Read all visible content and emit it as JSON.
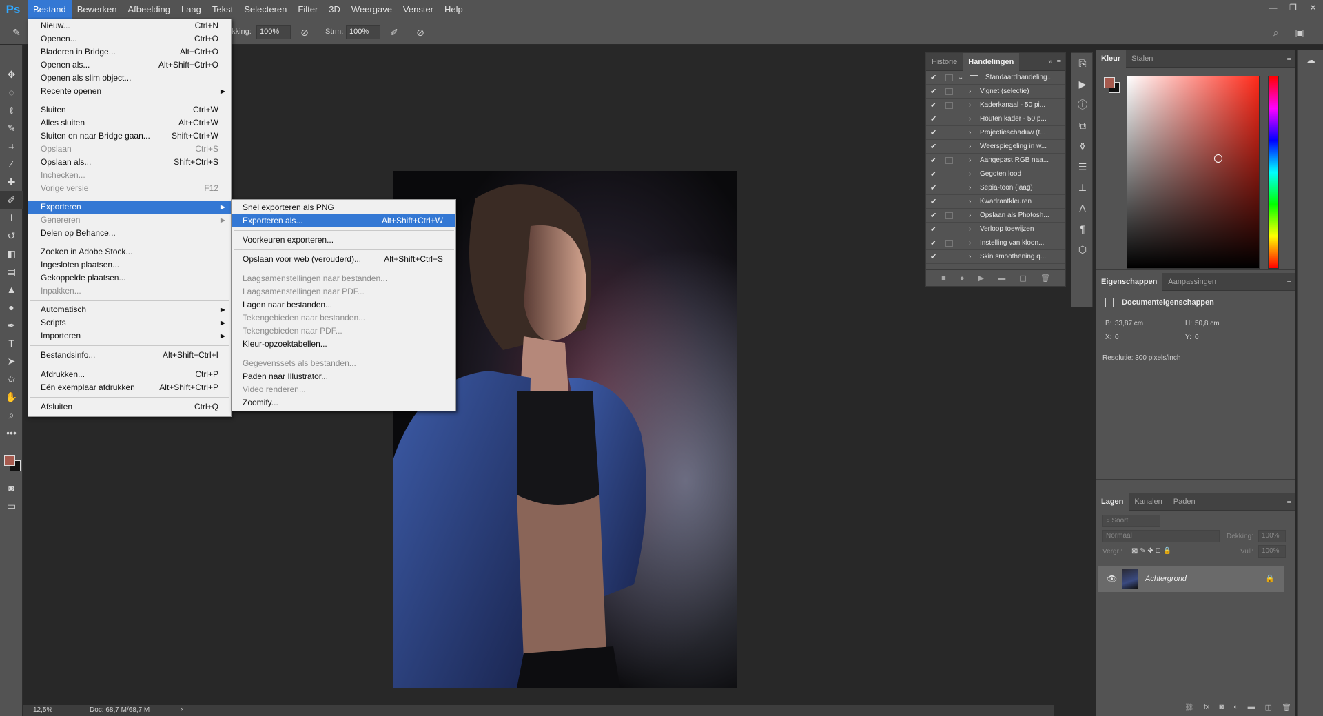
{
  "app": {
    "logo": "Ps"
  },
  "menubar": {
    "items": [
      "Bestand",
      "Bewerken",
      "Afbeelding",
      "Laag",
      "Tekst",
      "Selecteren",
      "Filter",
      "3D",
      "Weergave",
      "Venster",
      "Help"
    ],
    "active": "Bestand"
  },
  "window_controls": [
    "—",
    "❐",
    "✕"
  ],
  "optionsbar": {
    "opacity_label": "ekking:",
    "opacity_value": "100%",
    "flow_label": "Strm:",
    "flow_value": "100%"
  },
  "file_menu": {
    "items": [
      {
        "label": "Nieuw...",
        "shortcut": "Ctrl+N"
      },
      {
        "label": "Openen...",
        "shortcut": "Ctrl+O"
      },
      {
        "label": "Bladeren in Bridge...",
        "shortcut": "Alt+Ctrl+O"
      },
      {
        "label": "Openen als...",
        "shortcut": "Alt+Shift+Ctrl+O"
      },
      {
        "label": "Openen als slim object...",
        "shortcut": ""
      },
      {
        "label": "Recente openen",
        "shortcut": "",
        "submenu": true
      },
      {
        "label": "Sluiten",
        "shortcut": "Ctrl+W"
      },
      {
        "label": "Alles sluiten",
        "shortcut": "Alt+Ctrl+W"
      },
      {
        "label": "Sluiten en naar Bridge gaan...",
        "shortcut": "Shift+Ctrl+W"
      },
      {
        "label": "Opslaan",
        "shortcut": "Ctrl+S",
        "disabled": true
      },
      {
        "label": "Opslaan als...",
        "shortcut": "Shift+Ctrl+S"
      },
      {
        "label": "Inchecken...",
        "shortcut": "",
        "disabled": true
      },
      {
        "label": "Vorige versie",
        "shortcut": "F12",
        "disabled": true
      },
      {
        "label": "Exporteren",
        "shortcut": "",
        "submenu": true,
        "highlighted": true
      },
      {
        "label": "Genereren",
        "shortcut": "",
        "submenu": true,
        "disabled": true
      },
      {
        "label": "Delen op Behance...",
        "shortcut": ""
      },
      {
        "label": "Zoeken in Adobe Stock...",
        "shortcut": ""
      },
      {
        "label": "Ingesloten plaatsen...",
        "shortcut": ""
      },
      {
        "label": "Gekoppelde plaatsen...",
        "shortcut": ""
      },
      {
        "label": "Inpakken...",
        "shortcut": "",
        "disabled": true
      },
      {
        "label": "Automatisch",
        "shortcut": "",
        "submenu": true
      },
      {
        "label": "Scripts",
        "shortcut": "",
        "submenu": true
      },
      {
        "label": "Importeren",
        "shortcut": "",
        "submenu": true
      },
      {
        "label": "Bestandsinfo...",
        "shortcut": "Alt+Shift+Ctrl+I"
      },
      {
        "label": "Afdrukken...",
        "shortcut": "Ctrl+P"
      },
      {
        "label": "Eén exemplaar afdrukken",
        "shortcut": "Alt+Shift+Ctrl+P"
      },
      {
        "label": "Afsluiten",
        "shortcut": "Ctrl+Q"
      }
    ]
  },
  "export_menu": {
    "items": [
      {
        "label": "Snel exporteren als PNG",
        "shortcut": ""
      },
      {
        "label": "Exporteren als...",
        "shortcut": "Alt+Shift+Ctrl+W",
        "highlighted": true
      },
      {
        "label": "Voorkeuren exporteren...",
        "shortcut": ""
      },
      {
        "label": "Opslaan voor web (verouderd)...",
        "shortcut": "Alt+Shift+Ctrl+S"
      },
      {
        "label": "Laagsamenstellingen naar bestanden...",
        "shortcut": "",
        "disabled": true
      },
      {
        "label": "Laagsamenstellingen naar PDF...",
        "shortcut": "",
        "disabled": true
      },
      {
        "label": "Lagen naar bestanden...",
        "shortcut": ""
      },
      {
        "label": "Tekengebieden naar bestanden...",
        "shortcut": "",
        "disabled": true
      },
      {
        "label": "Tekengebieden naar PDF...",
        "shortcut": "",
        "disabled": true
      },
      {
        "label": "Kleur-opzoektabellen...",
        "shortcut": ""
      },
      {
        "label": "Gegevenssets als bestanden...",
        "shortcut": "",
        "disabled": true
      },
      {
        "label": "Paden naar Illustrator...",
        "shortcut": ""
      },
      {
        "label": "Video renderen...",
        "shortcut": "",
        "disabled": true
      },
      {
        "label": "Zoomify...",
        "shortcut": ""
      }
    ]
  },
  "actions_panel": {
    "tabs": [
      "Historie",
      "Handelingen"
    ],
    "active_tab": "Handelingen",
    "set_name": "Standaardhandeling...",
    "actions": [
      {
        "name": "Vignet (selectie)",
        "dialog": true
      },
      {
        "name": "Kaderkanaal - 50 pi...",
        "dialog": true
      },
      {
        "name": "Houten kader - 50 p...",
        "dialog": false
      },
      {
        "name": "Projectieschaduw (t...",
        "dialog": false
      },
      {
        "name": "Weerspiegeling in w...",
        "dialog": false
      },
      {
        "name": "Aangepast RGB naa...",
        "dialog": true
      },
      {
        "name": "Gegoten lood",
        "dialog": false
      },
      {
        "name": "Sepia-toon (laag)",
        "dialog": false
      },
      {
        "name": "Kwadrantkleuren",
        "dialog": false
      },
      {
        "name": "Opslaan als Photosh...",
        "dialog": true
      },
      {
        "name": "Verloop toewijzen",
        "dialog": false
      },
      {
        "name": "Instelling van kloon...",
        "dialog": true
      },
      {
        "name": "Skin smoothening q...",
        "dialog": false
      }
    ]
  },
  "color_panel": {
    "tabs": [
      "Kleur",
      "Stalen"
    ],
    "active_tab": "Kleur",
    "foreground": "#a65a4e",
    "background": "#111111"
  },
  "properties_panel": {
    "tabs": [
      "Eigenschappen",
      "Aanpassingen"
    ],
    "active_tab": "Eigenschappen",
    "header": "Documenteigenschappen",
    "width_label": "B:",
    "width_value": "33,87 cm",
    "height_label": "H:",
    "height_value": "50,8 cm",
    "x_label": "X:",
    "x_value": "0",
    "y_label": "Y:",
    "y_value": "0",
    "resolution": "Resolutie: 300 pixels/inch"
  },
  "layers_panel": {
    "tabs": [
      "Lagen",
      "Kanalen",
      "Paden"
    ],
    "active_tab": "Lagen",
    "filter_placeholder": "Soort",
    "blend_mode": "Normaal",
    "opacity_label": "Dekking:",
    "opacity_value": "100%",
    "lock_label": "Vergr.:",
    "fill_label": "Vull:",
    "fill_value": "100%",
    "layers": [
      {
        "name": "Achtergrond",
        "locked": true
      }
    ]
  },
  "statusbar": {
    "zoom": "12,5%",
    "doc": "Doc: 68,7 M/68,7 M"
  }
}
